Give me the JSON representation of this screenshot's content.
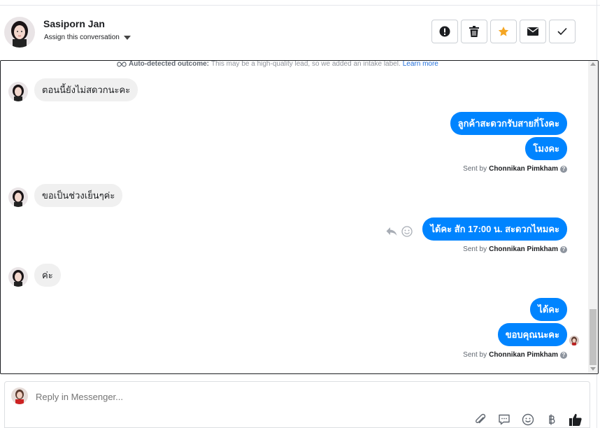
{
  "contact": {
    "name": "Sasiporn Jan",
    "assign_label": "Assign this conversation"
  },
  "actions": [
    "spam-icon",
    "trash-icon",
    "star-icon",
    "mail-icon",
    "check-icon"
  ],
  "colors": {
    "accent": "#0084ff",
    "star": "#f5a623",
    "incoming_bubble": "#f0f0f0"
  },
  "notice": {
    "title": "Auto-detected outcome:",
    "text": "This may be a high-quality lead, so we added an intake label.",
    "link": "Learn more"
  },
  "messages": [
    {
      "dir": "in",
      "text": "ตอนนี้ยังไม่สดวกนะคะ"
    },
    {
      "dir": "out",
      "text": "ลูกค้าสะดวกรับสายกี่โงคะ"
    },
    {
      "dir": "out",
      "text": "โมงคะ"
    },
    {
      "dir": "in",
      "text": "ขอเป็นช่วงเย็นๆค่ะ"
    },
    {
      "dir": "out",
      "text": "ได้คะ สัก 17:00 น. สะดวกไหมคะ"
    },
    {
      "dir": "in",
      "text": "ค่ะ"
    },
    {
      "dir": "out",
      "text": "ได้คะ"
    },
    {
      "dir": "out",
      "text": "ขอบคุณนะคะ"
    }
  ],
  "sent_by": {
    "prefix": "Sent by",
    "agent": "Chonnikan Pimkham"
  },
  "composer": {
    "placeholder": "Reply in Messenger...",
    "tools": [
      "paperclip-icon",
      "chat-bubble-icon",
      "emoji-icon",
      "baht-icon",
      "thumbs-up-icon"
    ]
  }
}
